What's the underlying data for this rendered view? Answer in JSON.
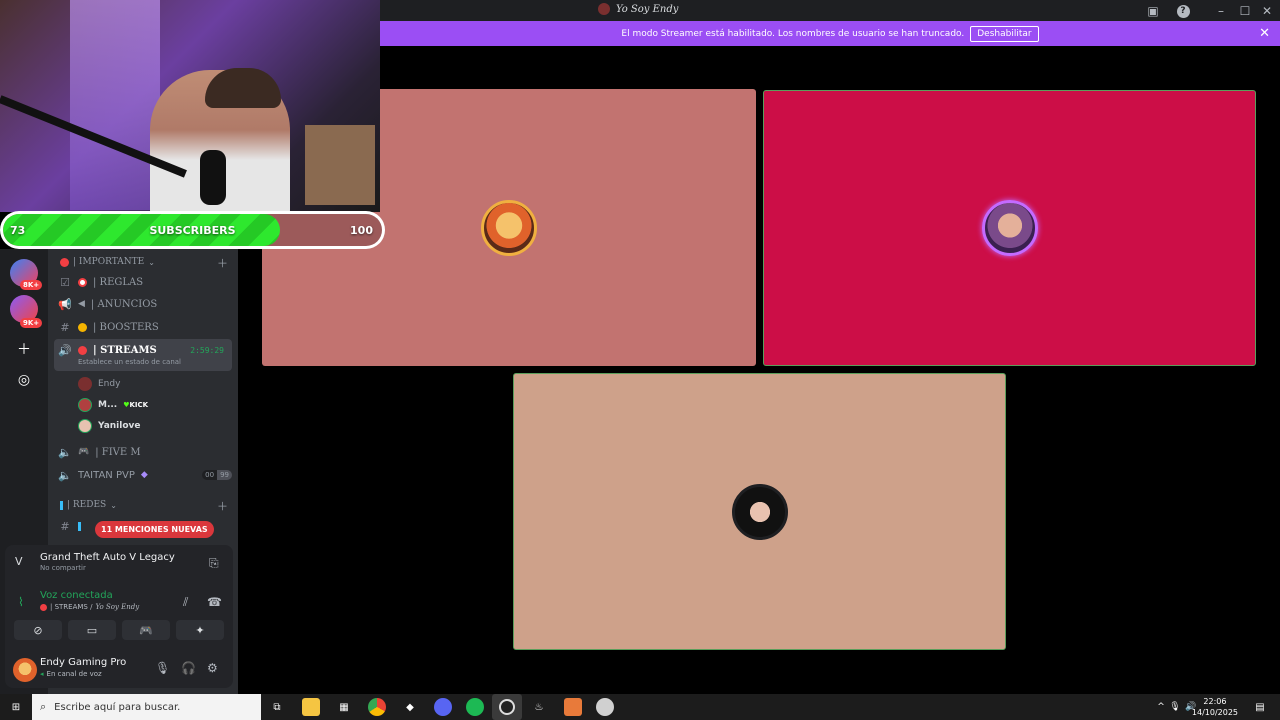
{
  "window": {
    "title": "Yo Soy Endy",
    "controls": [
      "inbox-icon",
      "help-icon",
      "minimize",
      "maximize",
      "close"
    ]
  },
  "banner": {
    "message": "El modo Streamer está habilitado. Los nombres de usuario se han truncado.",
    "button_label": "Deshabilitar",
    "color": "#9b4ef4"
  },
  "video_tiles": [
    {
      "name": "tile-1",
      "color": "#c27370"
    },
    {
      "name": "tile-2",
      "color": "#cc0e47"
    },
    {
      "name": "tile-3",
      "color": "#cea18a"
    }
  ],
  "sub_goal": {
    "current": "73",
    "label": "SUBSCRIBERS",
    "goal": "100",
    "progress": 0.73
  },
  "guilds": {
    "badges": [
      "8K+",
      "9K+"
    ]
  },
  "sidebar": {
    "categories": {
      "importante": "| IMPORTANTE",
      "redes": "| REDES"
    },
    "channels": [
      {
        "label": "| REGLAS"
      },
      {
        "label": "| ANUNCIOS"
      },
      {
        "label": "| BOOSTERS"
      },
      {
        "label": "| STREAMS",
        "time": "2:59:29",
        "status": "Establece un estado de canal"
      },
      {
        "label": "| FIVE M"
      },
      {
        "label": "TAITAN PVP",
        "count_a": "00",
        "count_b": "99"
      }
    ],
    "voice_members": [
      {
        "name": "Endy"
      },
      {
        "name": "M...",
        "tag": "KICK"
      },
      {
        "name": "Yanilove"
      }
    ],
    "mentions_label": "11 MENCIONES NUEVAS"
  },
  "voice_panel": {
    "activity_title": "Grand Theft Auto V Legacy",
    "activity_sub": "No compartir",
    "voice_status": "Voz conectada",
    "voice_channel": "| STREAMS /",
    "voice_server": "Yo Soy Endy",
    "user_name": "Endy Gaming Pro",
    "user_status": "En canal de voz"
  },
  "taskbar": {
    "search_placeholder": "Escribe aquí para buscar.",
    "time": "22:06",
    "date": "14/10/2025"
  }
}
